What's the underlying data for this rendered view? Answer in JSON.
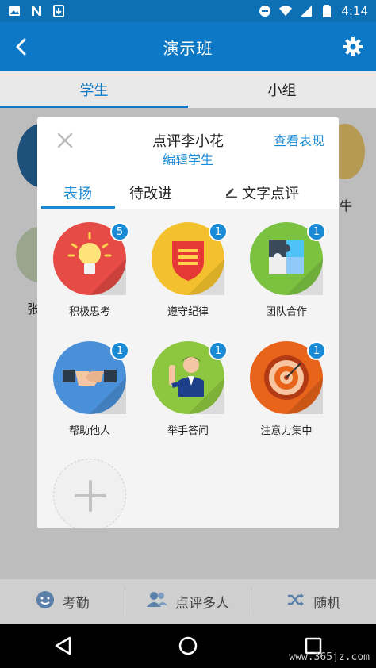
{
  "statusbar": {
    "time": "4:14",
    "left_icons": [
      "image-icon",
      "n-icon",
      "download-icon"
    ],
    "right_icons": [
      "dnd-icon",
      "wifi-icon",
      "signal-icon",
      "battery-icon"
    ]
  },
  "appbar": {
    "title": "演示班"
  },
  "main_tabs": [
    {
      "label": "学生",
      "active": true
    },
    {
      "label": "小组",
      "active": false
    }
  ],
  "background": {
    "name_1": "张",
    "name_2": "牛"
  },
  "modal": {
    "title": "点评李小花",
    "edit_link": "编辑学生",
    "view_link": "查看表现",
    "tabs": [
      {
        "label": "表扬",
        "active": true
      },
      {
        "label": "待改进",
        "active": false
      },
      {
        "label": "文字点评",
        "active": false,
        "icon": "pencil-icon"
      }
    ],
    "items": [
      {
        "label": "积极思考",
        "badge": "5",
        "color": "#e64b45",
        "icon": "lightbulb-icon"
      },
      {
        "label": "遵守纪律",
        "badge": "1",
        "color": "#f3c12e",
        "icon": "shield-icon"
      },
      {
        "label": "团队合作",
        "badge": "1",
        "color": "#7cc241",
        "icon": "puzzle-icon"
      },
      {
        "label": "帮助他人",
        "badge": "1",
        "color": "#4a90d9",
        "icon": "handshake-icon"
      },
      {
        "label": "举手答问",
        "badge": "1",
        "color": "#8dc63f",
        "icon": "raise-hand-icon"
      },
      {
        "label": "注意力集中",
        "badge": "1",
        "color": "#e8641b",
        "icon": "target-icon"
      }
    ],
    "add_icon": "plus-icon"
  },
  "actions": [
    {
      "label": "考勤",
      "icon": "smiley-icon"
    },
    {
      "label": "点评多人",
      "icon": "people-icon"
    },
    {
      "label": "随机",
      "icon": "shuffle-icon"
    }
  ],
  "watermark": "www.365jz.com",
  "colors": {
    "primary": "#0d79c6",
    "accent": "#1a8ad4",
    "badge": "#1a8ad4"
  }
}
